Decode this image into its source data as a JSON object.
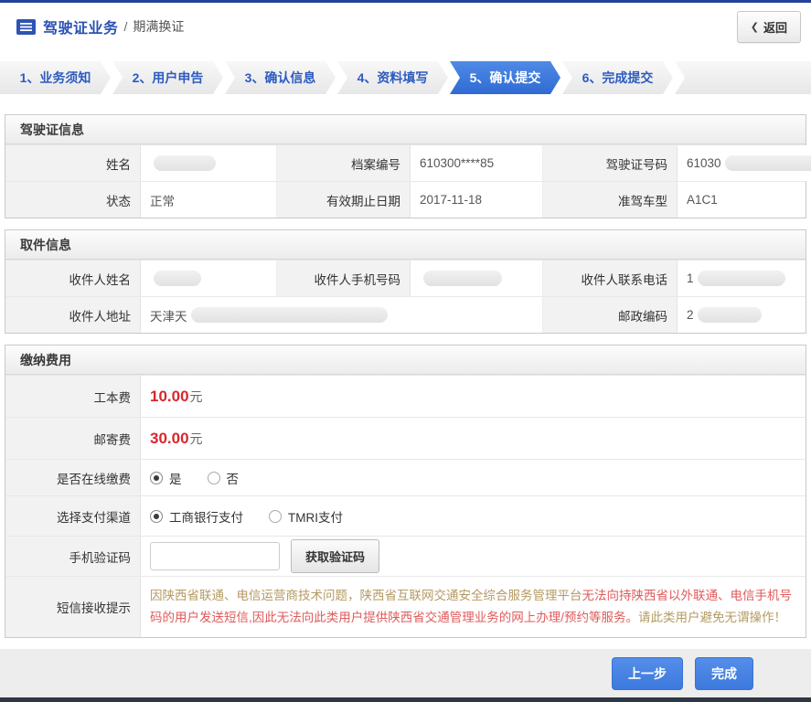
{
  "header": {
    "breadcrumb": {
      "section": "驾驶证业务",
      "separator": "/",
      "current": "期满换证"
    },
    "back_icon": "❮",
    "back_label": "返回"
  },
  "wizard": {
    "steps": [
      {
        "label": "1、业务须知",
        "active": false
      },
      {
        "label": "2、用户申告",
        "active": false
      },
      {
        "label": "3、确认信息",
        "active": false
      },
      {
        "label": "4、资料填写",
        "active": false
      },
      {
        "label": "5、确认提交",
        "active": true
      },
      {
        "label": "6、完成提交",
        "active": false
      }
    ]
  },
  "license": {
    "title": "驾驶证信息",
    "rows": [
      [
        {
          "label": "姓名",
          "value": "",
          "masked": true
        },
        {
          "label": "档案编号",
          "value": "610300****85"
        },
        {
          "label": "驾驶证号码",
          "value": "61030",
          "masked": true
        }
      ],
      [
        {
          "label": "状态",
          "value": "正常"
        },
        {
          "label": "有效期止日期",
          "value": "2017-11-18"
        },
        {
          "label": "准驾车型",
          "value": "A1C1"
        }
      ]
    ]
  },
  "pickup": {
    "title": "取件信息",
    "recipient_name": {
      "label": "收件人姓名",
      "value": "",
      "masked": true
    },
    "mobile": {
      "label": "收件人手机号码",
      "value": "",
      "masked": true
    },
    "contact_phone": {
      "label": "收件人联系电话",
      "value": "1",
      "masked": true
    },
    "address": {
      "label": "收件人地址",
      "value": "天津天",
      "masked": true
    },
    "postal_code": {
      "label": "邮政编码",
      "value": "2",
      "masked": true
    }
  },
  "fees": {
    "title": "缴纳费用",
    "fee_rows": [
      {
        "label": "工本费",
        "amount": "10.00",
        "unit": "元"
      },
      {
        "label": "邮寄费",
        "amount": "30.00",
        "unit": "元"
      }
    ],
    "online_pay": {
      "label": "是否在线缴费",
      "options": [
        {
          "text": "是",
          "selected": true
        },
        {
          "text": "否",
          "selected": false
        }
      ]
    },
    "channel": {
      "label": "选择支付渠道",
      "options": [
        {
          "text": "工商银行支付",
          "selected": true
        },
        {
          "text": "TMRI支付",
          "selected": false
        }
      ]
    },
    "sms_code": {
      "label": "手机验证码",
      "input_value": "",
      "button_label": "获取验证码"
    },
    "notice": {
      "label": "短信接收提示",
      "segments": [
        {
          "text": "因陕西省联通、电信运营商技术问题，陕西省互联网交通安全综合服务管理平台",
          "color": "#b49a62"
        },
        {
          "text": "无法向持陕西省以外联通、电信手机号码的用户发送短信,因此无法向此类用户提供陕西省交通管理业务的网上办理/预约等服务。",
          "color": "#e05a5a"
        },
        {
          "text": "请此类用户避免无谓操作！",
          "color": "#b49a62"
        }
      ]
    }
  },
  "footer": {
    "prev_button": "上一步",
    "finish_button": "完成"
  },
  "colors": {
    "accent_blue": "#2d5bbf",
    "active_step": "#3b76dc",
    "price_red": "#d9262c",
    "notice_tan": "#b49a62",
    "notice_red": "#e05a5a",
    "top_bar": "#24419c",
    "footer_bar": "#2f3744"
  }
}
